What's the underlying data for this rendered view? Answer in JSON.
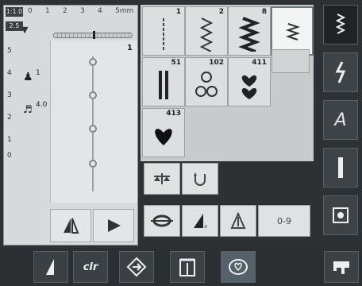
{
  "left_panel": {
    "scale_badge": "1:1.0",
    "width_badge": "2.5",
    "ruler": [
      "0",
      "1",
      "2",
      "3",
      "4",
      "5mm"
    ],
    "side_scale": [
      "5",
      "4",
      "3",
      "2",
      "1",
      "0"
    ],
    "side_icon_b_num": "1",
    "side_icon_c_num": "4.0",
    "pattern_count": "1"
  },
  "grid": {
    "cells": [
      {
        "num": "1",
        "icon": "straight-stitch-icon"
      },
      {
        "num": "2",
        "icon": "zigzag-stitch-icon"
      },
      {
        "num": "8",
        "icon": "triple-zigzag-icon"
      },
      {
        "num": "",
        "icon": "zigzag-selected-icon"
      },
      {
        "num": "51",
        "icon": "double-straight-icon"
      },
      {
        "num": "102",
        "icon": "flower-motif-icon"
      },
      {
        "num": "411",
        "icon": "heart-stitch-icon"
      },
      {
        "num": "413",
        "icon": "heart-solid-icon"
      }
    ]
  },
  "functions": {
    "balance_label": "balance",
    "undo_label": "undo",
    "counter_label": "0-9"
  },
  "right_bar": [
    "practical-stitches-icon",
    "decorative-stitches-icon",
    "alphabet-icon",
    "buttonhole-icon",
    "quilt-stitches-icon"
  ],
  "bottom_bar": {
    "clr_label": "clr"
  }
}
